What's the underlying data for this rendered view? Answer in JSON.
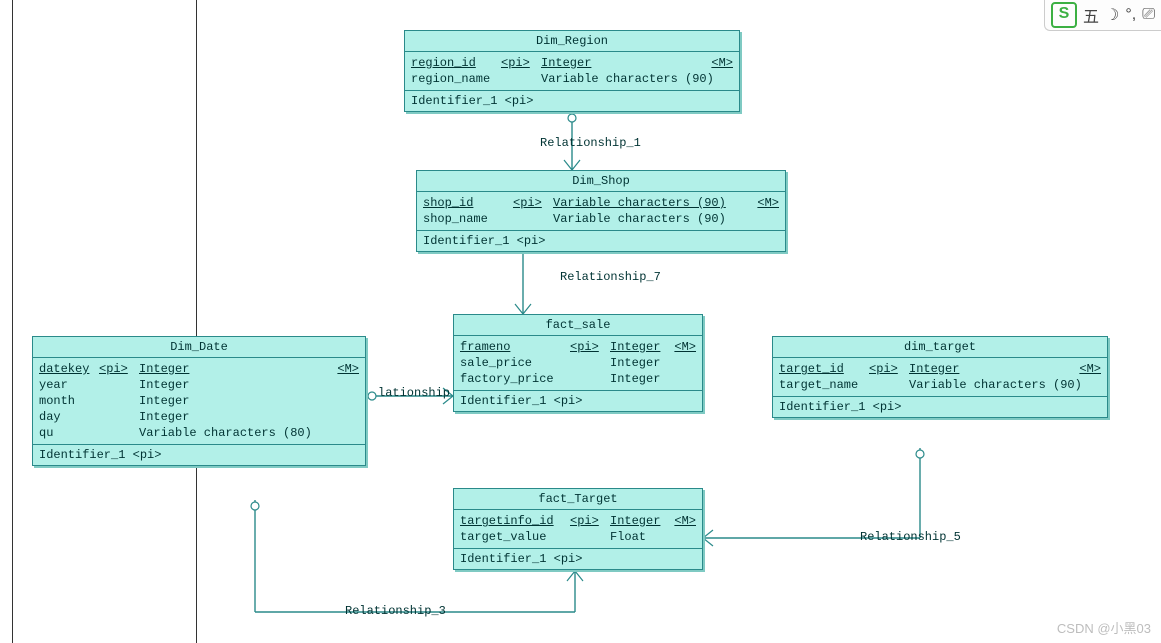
{
  "entities": {
    "dim_region": {
      "title": "Dim_Region",
      "attrs": [
        {
          "name": "region_id",
          "pi": "<pi>",
          "type": "Integer",
          "m": "<M>",
          "ul_name": true,
          "ul_pi": true,
          "ul_type": true,
          "ul_m": true
        },
        {
          "name": "region_name",
          "pi": "",
          "type": "Variable characters (90)",
          "m": "",
          "ul_name": false,
          "ul_pi": false,
          "ul_type": false,
          "ul_m": false
        }
      ],
      "identifier": "Identifier_1 <pi>"
    },
    "dim_shop": {
      "title": "Dim_Shop",
      "attrs": [
        {
          "name": "shop_id",
          "pi": "<pi>",
          "type": "Variable characters (90)",
          "m": "<M>",
          "ul_name": true,
          "ul_pi": true,
          "ul_type": true,
          "ul_m": true
        },
        {
          "name": "shop_name",
          "pi": "",
          "type": "Variable characters (90)",
          "m": "",
          "ul_name": false,
          "ul_pi": false,
          "ul_type": false,
          "ul_m": false
        }
      ],
      "identifier": "Identifier_1 <pi>"
    },
    "fact_sale": {
      "title": "fact_sale",
      "attrs": [
        {
          "name": "frameno",
          "pi": "<pi>",
          "type": "Integer",
          "m": "<M>",
          "ul_name": true,
          "ul_pi": true,
          "ul_type": true,
          "ul_m": true
        },
        {
          "name": "sale_price",
          "pi": "",
          "type": "Integer",
          "m": "",
          "ul_name": false,
          "ul_pi": false,
          "ul_type": false,
          "ul_m": false
        },
        {
          "name": "factory_price",
          "pi": "",
          "type": "Integer",
          "m": "",
          "ul_name": false,
          "ul_pi": false,
          "ul_type": false,
          "ul_m": false
        }
      ],
      "identifier": "Identifier_1 <pi>"
    },
    "dim_date": {
      "title": "Dim_Date",
      "attrs": [
        {
          "name": "datekey",
          "pi": "<pi>",
          "type": "Integer",
          "m": "<M>",
          "ul_name": true,
          "ul_pi": true,
          "ul_type": true,
          "ul_m": true
        },
        {
          "name": "year",
          "pi": "",
          "type": "Integer",
          "m": "",
          "ul_name": false,
          "ul_pi": false,
          "ul_type": false,
          "ul_m": false
        },
        {
          "name": "month",
          "pi": "",
          "type": "Integer",
          "m": "",
          "ul_name": false,
          "ul_pi": false,
          "ul_type": false,
          "ul_m": false
        },
        {
          "name": "day",
          "pi": "",
          "type": "Integer",
          "m": "",
          "ul_name": false,
          "ul_pi": false,
          "ul_type": false,
          "ul_m": false
        },
        {
          "name": "qu",
          "pi": "",
          "type": "Variable characters (80)",
          "m": "",
          "ul_name": false,
          "ul_pi": false,
          "ul_type": false,
          "ul_m": false
        }
      ],
      "identifier": "Identifier_1 <pi>"
    },
    "dim_target": {
      "title": "dim_target",
      "attrs": [
        {
          "name": "target_id",
          "pi": "<pi>",
          "type": "Integer",
          "m": "<M>",
          "ul_name": true,
          "ul_pi": true,
          "ul_type": true,
          "ul_m": true
        },
        {
          "name": "target_name",
          "pi": "",
          "type": "Variable characters (90)",
          "m": "",
          "ul_name": false,
          "ul_pi": false,
          "ul_type": false,
          "ul_m": false
        }
      ],
      "identifier": "Identifier_1 <pi>"
    },
    "fact_target": {
      "title": "fact_Target",
      "attrs": [
        {
          "name": "targetinfo_id",
          "pi": "<pi>",
          "type": "Integer",
          "m": "<M>",
          "ul_name": true,
          "ul_pi": true,
          "ul_type": true,
          "ul_m": true
        },
        {
          "name": "target_value",
          "pi": "",
          "type": "Float",
          "m": "",
          "ul_name": false,
          "ul_pi": false,
          "ul_type": false,
          "ul_m": false
        }
      ],
      "identifier": "Identifier_1 <pi>"
    }
  },
  "relationships": {
    "r1": "Relationship_1",
    "r7": "Relationship_7",
    "r_lat": "lationship",
    "r3": "Relationship_3",
    "r5": "Relationship_5"
  },
  "ime": {
    "logo": "S",
    "char": "五",
    "moon": "☽",
    "dot": "°,",
    "extra": "⎚"
  },
  "watermark": "CSDN @小黑03",
  "chart_data": {
    "type": "er-diagram",
    "entities": [
      {
        "name": "Dim_Region",
        "identifier": "Identifier_1 <pi>",
        "attributes": [
          {
            "name": "region_id",
            "pi": true,
            "type": "Integer",
            "mandatory": true
          },
          {
            "name": "region_name",
            "pi": false,
            "type": "Variable characters (90)",
            "mandatory": false
          }
        ]
      },
      {
        "name": "Dim_Shop",
        "identifier": "Identifier_1 <pi>",
        "attributes": [
          {
            "name": "shop_id",
            "pi": true,
            "type": "Variable characters (90)",
            "mandatory": true
          },
          {
            "name": "shop_name",
            "pi": false,
            "type": "Variable characters (90)",
            "mandatory": false
          }
        ]
      },
      {
        "name": "fact_sale",
        "identifier": "Identifier_1 <pi>",
        "attributes": [
          {
            "name": "frameno",
            "pi": true,
            "type": "Integer",
            "mandatory": true
          },
          {
            "name": "sale_price",
            "pi": false,
            "type": "Integer",
            "mandatory": false
          },
          {
            "name": "factory_price",
            "pi": false,
            "type": "Integer",
            "mandatory": false
          }
        ]
      },
      {
        "name": "Dim_Date",
        "identifier": "Identifier_1 <pi>",
        "attributes": [
          {
            "name": "datekey",
            "pi": true,
            "type": "Integer",
            "mandatory": true
          },
          {
            "name": "year",
            "pi": false,
            "type": "Integer",
            "mandatory": false
          },
          {
            "name": "month",
            "pi": false,
            "type": "Integer",
            "mandatory": false
          },
          {
            "name": "day",
            "pi": false,
            "type": "Integer",
            "mandatory": false
          },
          {
            "name": "qu",
            "pi": false,
            "type": "Variable characters (80)",
            "mandatory": false
          }
        ]
      },
      {
        "name": "dim_target",
        "identifier": "Identifier_1 <pi>",
        "attributes": [
          {
            "name": "target_id",
            "pi": true,
            "type": "Integer",
            "mandatory": true
          },
          {
            "name": "target_name",
            "pi": false,
            "type": "Variable characters (90)",
            "mandatory": false
          }
        ]
      },
      {
        "name": "fact_Target",
        "identifier": "Identifier_1 <pi>",
        "attributes": [
          {
            "name": "targetinfo_id",
            "pi": true,
            "type": "Integer",
            "mandatory": true
          },
          {
            "name": "target_value",
            "pi": false,
            "type": "Float",
            "mandatory": false
          }
        ]
      }
    ],
    "relationships": [
      {
        "name": "Relationship_1",
        "from": "Dim_Region",
        "to": "Dim_Shop",
        "from_card": "0..1",
        "to_card": "0..*"
      },
      {
        "name": "Relationship_7",
        "from": "Dim_Shop",
        "to": "fact_sale",
        "from_card": "0..1",
        "to_card": "0..*"
      },
      {
        "name": "Relationship",
        "from": "Dim_Date",
        "to": "fact_sale",
        "from_card": "0..1",
        "to_card": "0..*"
      },
      {
        "name": "Relationship_3",
        "from": "Dim_Date",
        "to": "fact_Target",
        "from_card": "0..1",
        "to_card": "0..*"
      },
      {
        "name": "Relationship_5",
        "from": "dim_target",
        "to": "fact_Target",
        "from_card": "0..1",
        "to_card": "0..*"
      }
    ]
  }
}
